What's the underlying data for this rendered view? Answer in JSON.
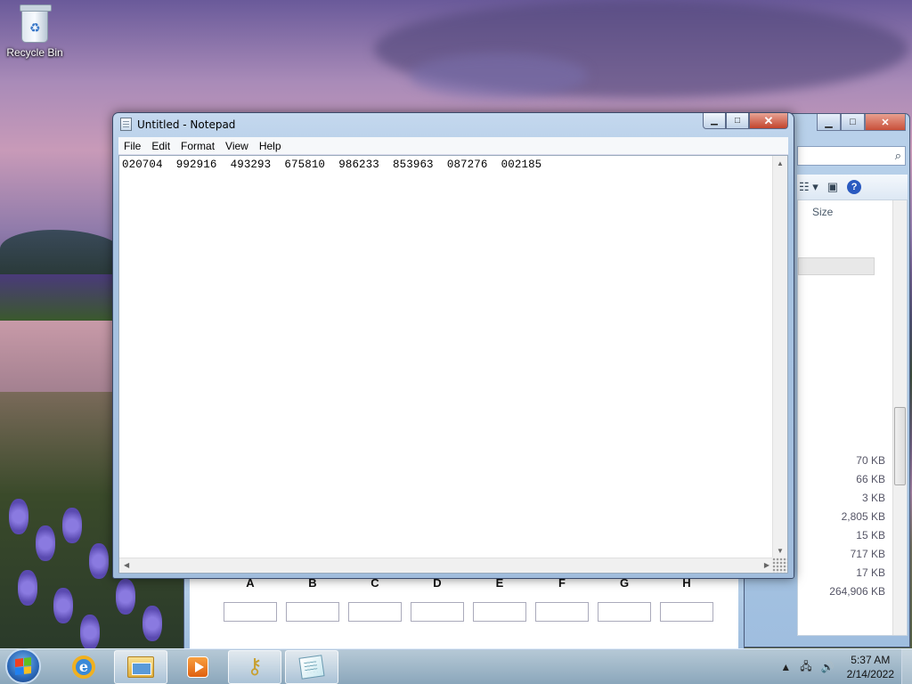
{
  "desktop": {
    "recycle_bin_label": "Recycle Bin"
  },
  "notepad": {
    "title": "Untitled - Notepad",
    "menu": [
      "File",
      "Edit",
      "Format",
      "View",
      "Help"
    ],
    "content": "020704  992916  493293  675810  986233  853963  087276  002185"
  },
  "explorer": {
    "size_header": "Size",
    "sizes": [
      "70 KB",
      "66 KB",
      "3 KB",
      "2,805 KB",
      "15 KB",
      "717 KB",
      "17 KB",
      "264,906 KB"
    ]
  },
  "form": {
    "columns": [
      "A",
      "B",
      "C",
      "D",
      "E",
      "F",
      "G",
      "H"
    ]
  },
  "taskbar": {
    "time": "5:37 AM",
    "date": "2/14/2022"
  },
  "icons": {
    "start": "windows-start-icon",
    "ie": "internet-explorer-icon",
    "explorer": "file-explorer-icon",
    "media": "media-player-icon",
    "keys": "keys-icon",
    "notepad": "notepad-icon"
  }
}
